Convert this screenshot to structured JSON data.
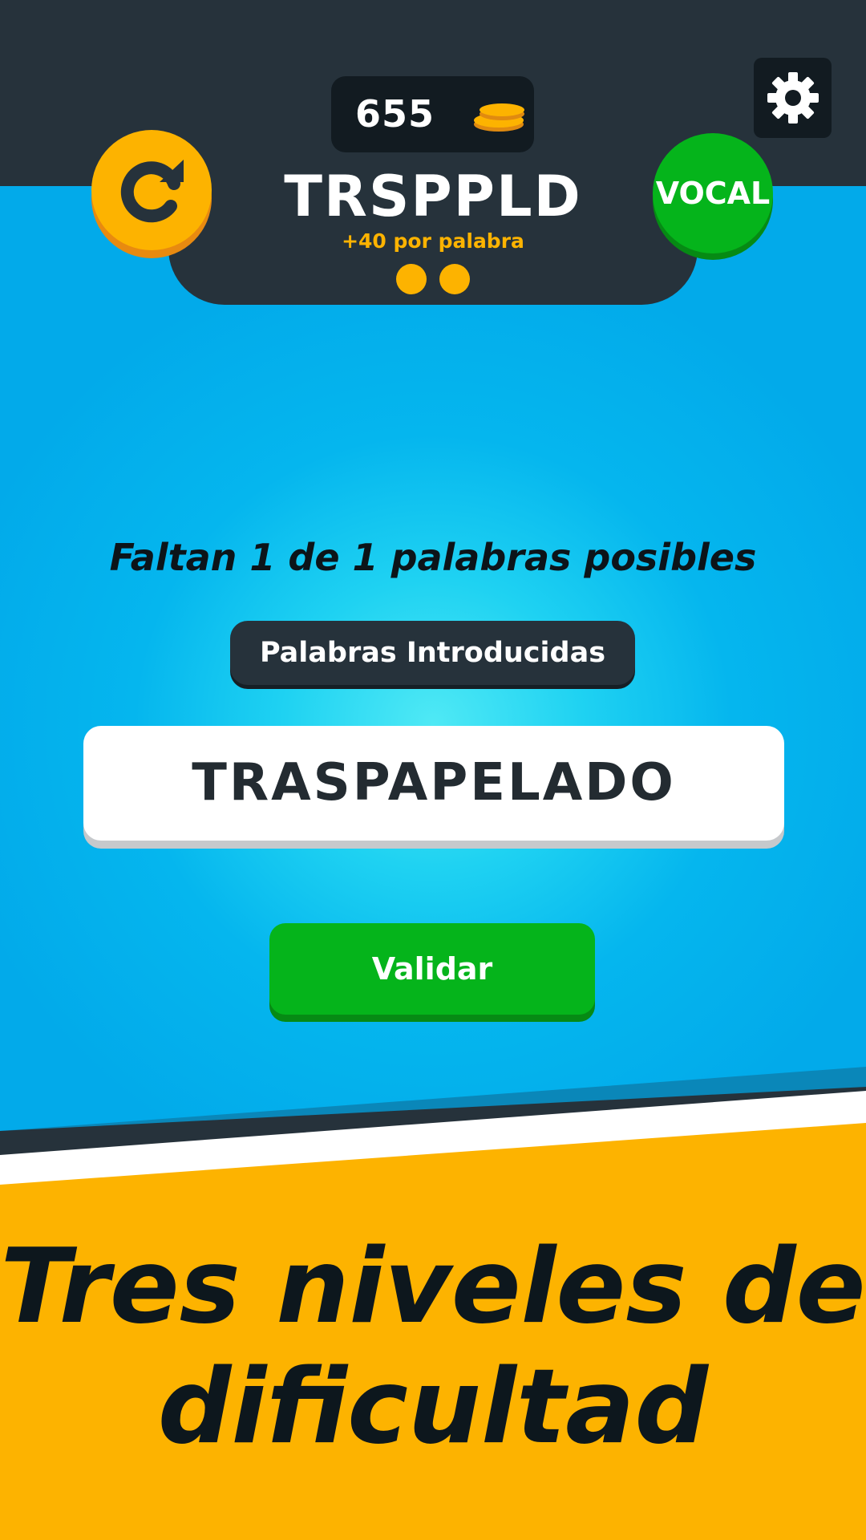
{
  "header": {
    "coins": "655",
    "letters": "TRSPPLD",
    "bonus_text": "+40 por palabra",
    "vocal_label": "VOCAL",
    "hint_dots": 2
  },
  "main": {
    "remaining_text": "Faltan 1 de 1 palabras posibles",
    "entered_label": "Palabras Introducidas",
    "entered_word": "TRASPAPELADO",
    "validate_label": "Validar"
  },
  "banner": {
    "line1": "Tres niveles de",
    "line2": "dificultad"
  },
  "icons": {
    "restart": "restart-icon",
    "settings": "gear-icon",
    "coins": "coin-stack-icon"
  },
  "colors": {
    "dark": "#26323b",
    "accent_yellow": "#fdb300",
    "green": "#05b41b",
    "sky": "#02aaea"
  }
}
